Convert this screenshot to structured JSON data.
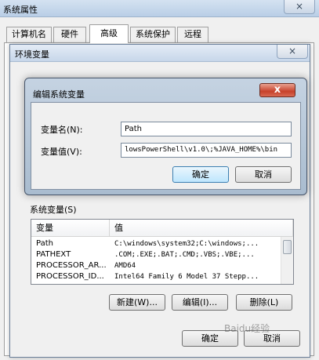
{
  "system_properties": {
    "title": "系统属性",
    "close_icon": "×",
    "tabs": [
      {
        "label": "计算机名"
      },
      {
        "label": "硬件"
      },
      {
        "label": "高级"
      },
      {
        "label": "系统保护"
      },
      {
        "label": "远程"
      }
    ],
    "active_tab": "高级"
  },
  "environment_variables": {
    "title": "环境变量",
    "close_icon": "×",
    "system_vars_label": "系统变量(S)",
    "columns": [
      "变量",
      "值"
    ],
    "rows": [
      {
        "name": "Path",
        "value": "C:\\windows\\system32;C:\\windows;..."
      },
      {
        "name": "PATHEXT",
        "value": ".COM;.EXE;.BAT;.CMD;.VBS;.VBE;..."
      },
      {
        "name": "PROCESSOR_AR...",
        "value": "AMD64"
      },
      {
        "name": "PROCESSOR_ID...",
        "value": "Intel64 Family 6 Model 37 Stepp..."
      }
    ],
    "buttons": {
      "new": "新建(W)...",
      "edit": "编辑(I)...",
      "delete": "删除(L)"
    },
    "footer": {
      "ok": "确定",
      "cancel": "取消"
    }
  },
  "edit_system_variable": {
    "title": "编辑系统变量",
    "close_icon": "x",
    "name_label": "变量名(N):",
    "name_value": "Path",
    "value_label": "变量值(V):",
    "value_value": "lowsPowerShell\\v1.0\\;%JAVA_HOME%\\bin",
    "ok": "确定",
    "cancel": "取消"
  },
  "watermark": "Baidu经验"
}
